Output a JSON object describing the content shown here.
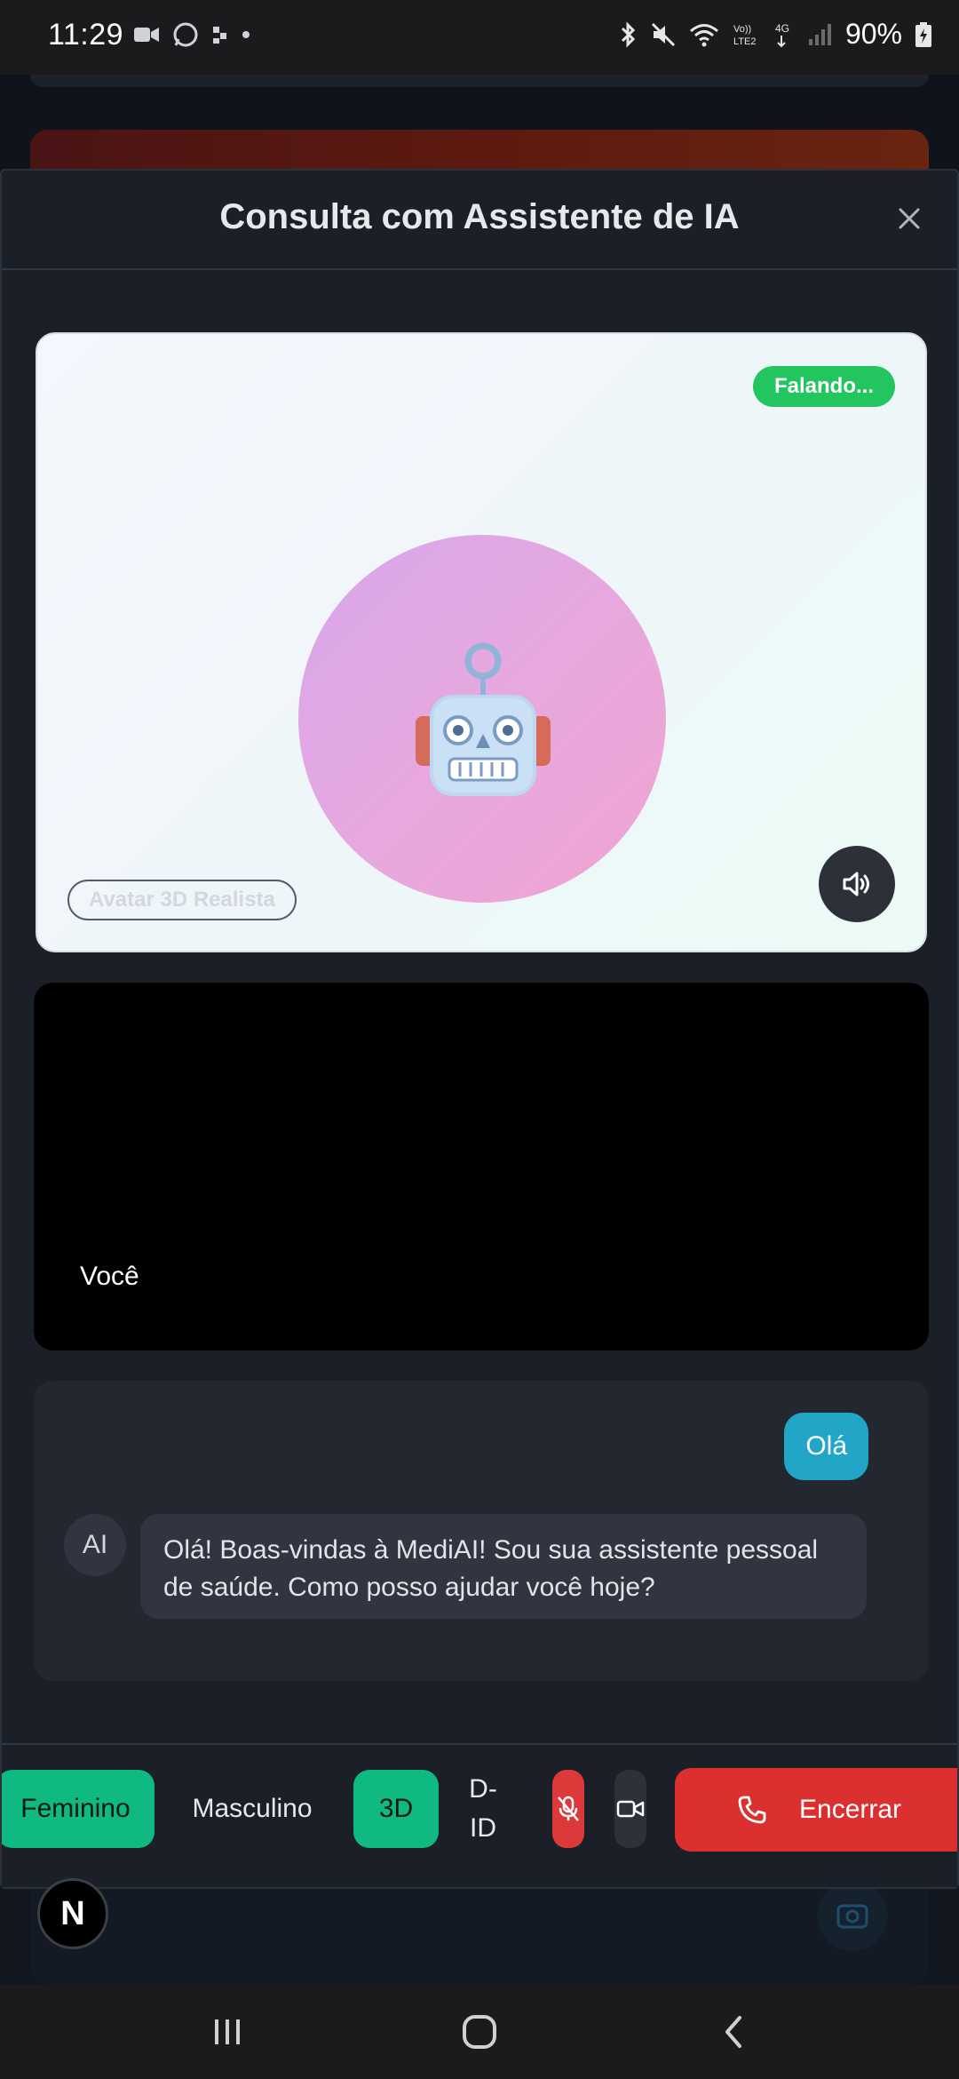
{
  "status_bar": {
    "time": "11:29",
    "battery": "90%",
    "network": "4G"
  },
  "modal": {
    "title": "Consulta com Assistente de IA"
  },
  "avatar_panel": {
    "speaking_badge": "Falando...",
    "mode_label": "Avatar 3D Realista",
    "avatar_emoji": "robot-icon"
  },
  "camera_panel": {
    "label": "Você"
  },
  "chat": {
    "messages": [
      {
        "role": "user",
        "text": "Olá"
      },
      {
        "role": "ai",
        "avatar": "AI",
        "text": "Olá! Boas-vindas à MediAI! Sou sua assistente pessoal de saúde. Como posso ajudar você hoje?"
      }
    ]
  },
  "controls": {
    "feminino": "Feminino",
    "masculino": "Masculino",
    "mode_3d": "3D",
    "mode_did_line1": "D-",
    "mode_did_line2": "ID",
    "end_call": "Encerrar"
  },
  "floating": {
    "n_label": "N"
  },
  "colors": {
    "accent_green": "#10b981",
    "speaking_green": "#22c55e",
    "user_bubble": "#22a6c7",
    "end_red": "#dc3030",
    "modal_bg": "#1b1f27"
  }
}
